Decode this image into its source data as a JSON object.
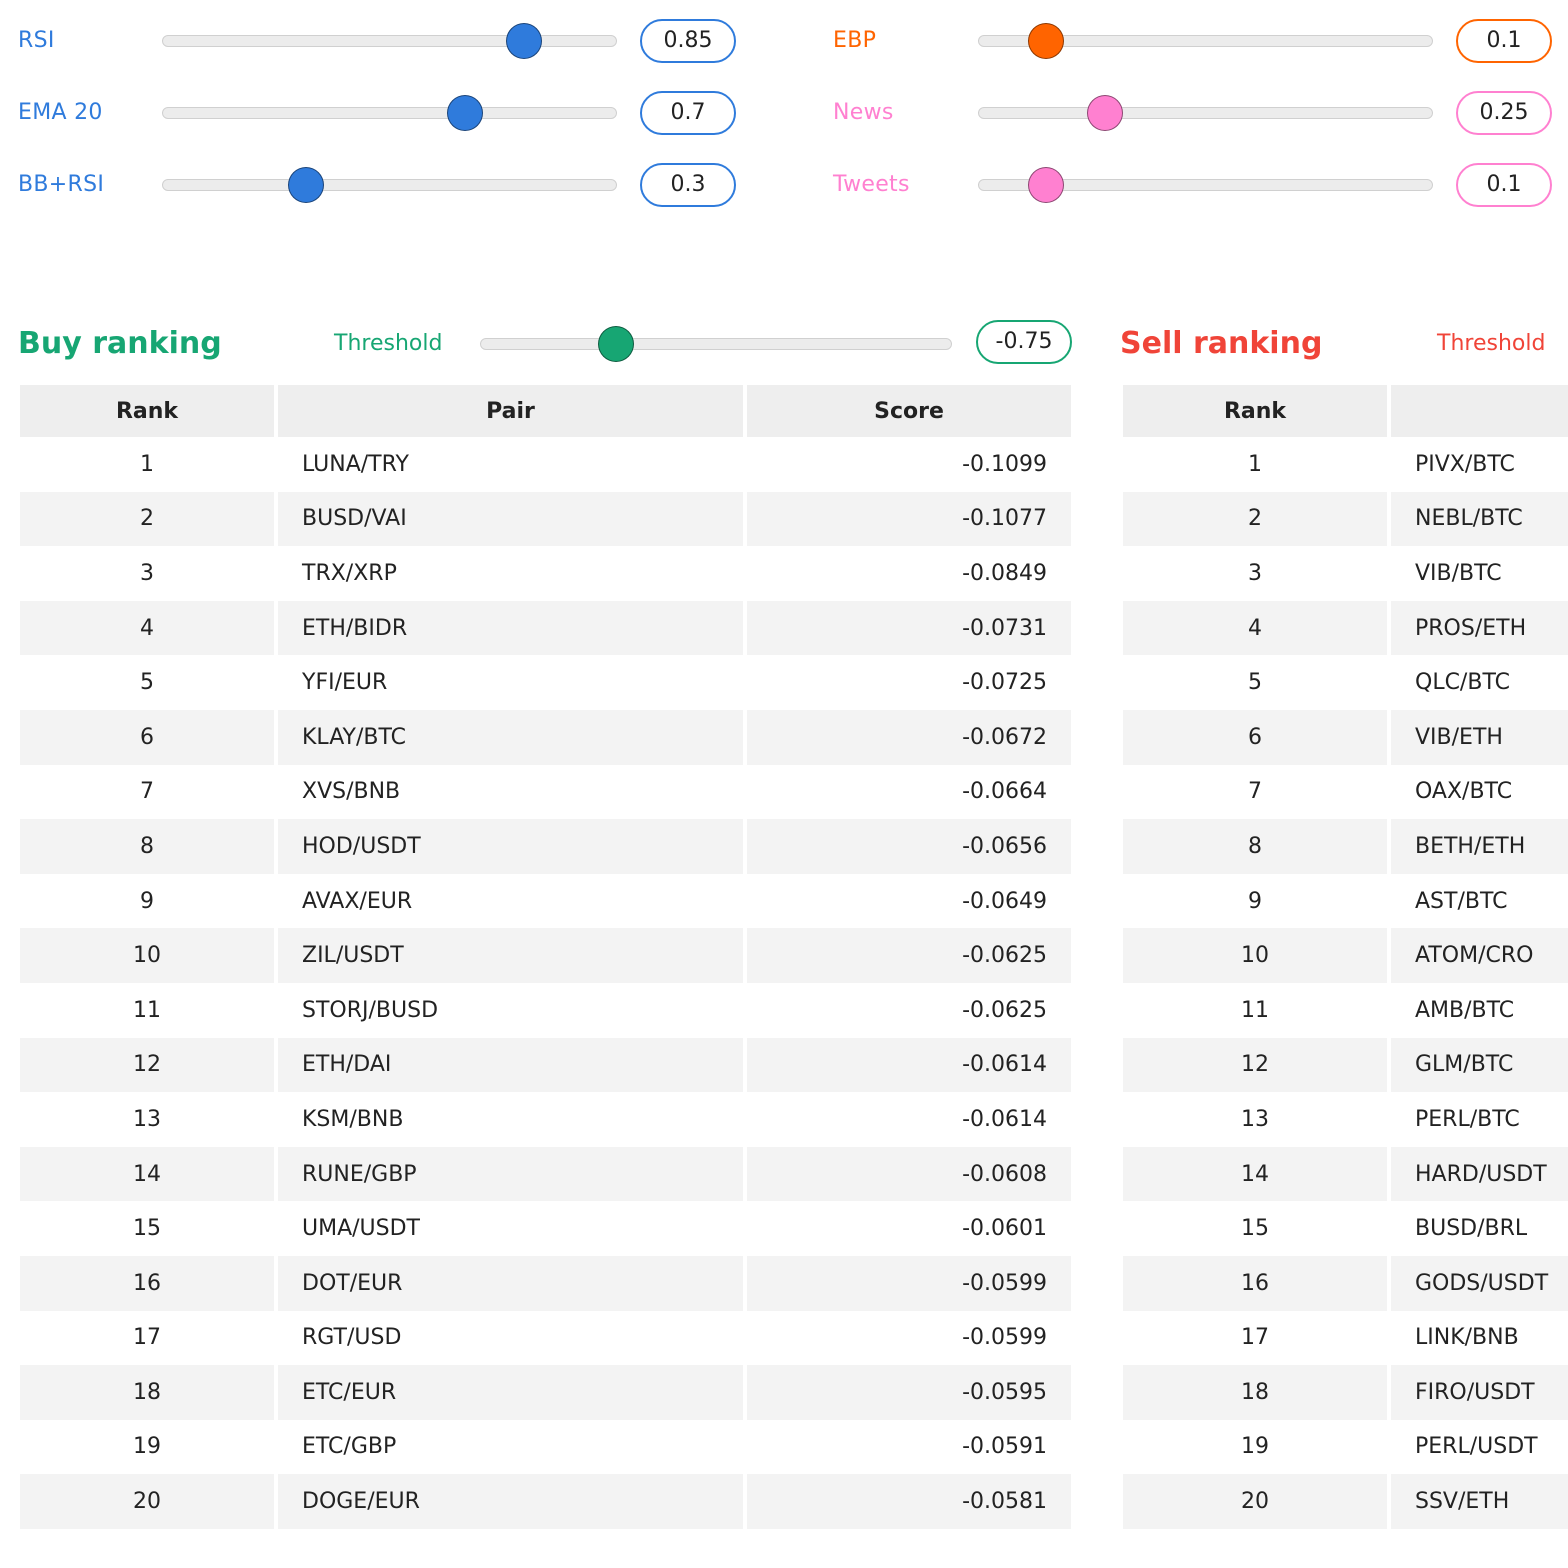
{
  "colors": {
    "blue": "#2f7bdc",
    "orange": "#ff6400",
    "pink": "#ff80d0",
    "green": "#17a673",
    "red": "#f04438"
  },
  "weights": [
    {
      "id": "rsi",
      "label": "RSI",
      "value": "0.85",
      "level": 0.82,
      "color": "#2f7bdc"
    },
    {
      "id": "ema20",
      "label": "EMA 20",
      "value": "0.7",
      "level": 0.68,
      "color": "#2f7bdc"
    },
    {
      "id": "bbrsi",
      "label": "BB+RSI",
      "value": "0.3",
      "level": 0.3,
      "color": "#2f7bdc"
    },
    {
      "id": "ebp",
      "label": "EBP",
      "value": "0.1",
      "level": 0.12,
      "color": "#ff6400"
    },
    {
      "id": "news",
      "label": "News",
      "value": "0.25",
      "level": 0.26,
      "color": "#ff80d0"
    },
    {
      "id": "tweets",
      "label": "Tweets",
      "value": "0.1",
      "level": 0.12,
      "color": "#ff80d0"
    }
  ],
  "buy": {
    "title": "Buy ranking",
    "threshold_label": "Threshold",
    "threshold_value": "-0.75",
    "threshold_level": 0.27,
    "headers": {
      "rank": "Rank",
      "pair": "Pair",
      "score": "Score"
    },
    "rows": [
      {
        "rank": "1",
        "pair": "LUNA/TRY",
        "score": "-0.1099"
      },
      {
        "rank": "2",
        "pair": "BUSD/VAI",
        "score": "-0.1077"
      },
      {
        "rank": "3",
        "pair": "TRX/XRP",
        "score": "-0.0849"
      },
      {
        "rank": "4",
        "pair": "ETH/BIDR",
        "score": "-0.0731"
      },
      {
        "rank": "5",
        "pair": "YFI/EUR",
        "score": "-0.0725"
      },
      {
        "rank": "6",
        "pair": "KLAY/BTC",
        "score": "-0.0672"
      },
      {
        "rank": "7",
        "pair": "XVS/BNB",
        "score": "-0.0664"
      },
      {
        "rank": "8",
        "pair": "HOD/USDT",
        "score": "-0.0656"
      },
      {
        "rank": "9",
        "pair": "AVAX/EUR",
        "score": "-0.0649"
      },
      {
        "rank": "10",
        "pair": "ZIL/USDT",
        "score": "-0.0625"
      },
      {
        "rank": "11",
        "pair": "STORJ/BUSD",
        "score": "-0.0625"
      },
      {
        "rank": "12",
        "pair": "ETH/DAI",
        "score": "-0.0614"
      },
      {
        "rank": "13",
        "pair": "KSM/BNB",
        "score": "-0.0614"
      },
      {
        "rank": "14",
        "pair": "RUNE/GBP",
        "score": "-0.0608"
      },
      {
        "rank": "15",
        "pair": "UMA/USDT",
        "score": "-0.0601"
      },
      {
        "rank": "16",
        "pair": "DOT/EUR",
        "score": "-0.0599"
      },
      {
        "rank": "17",
        "pair": "RGT/USD",
        "score": "-0.0599"
      },
      {
        "rank": "18",
        "pair": "ETC/EUR",
        "score": "-0.0595"
      },
      {
        "rank": "19",
        "pair": "ETC/GBP",
        "score": "-0.0591"
      },
      {
        "rank": "20",
        "pair": "DOGE/EUR",
        "score": "-0.0581"
      }
    ]
  },
  "sell": {
    "title": "Sell ranking",
    "threshold_label": "Threshold",
    "headers": {
      "rank": "Rank"
    },
    "rows": [
      {
        "rank": "1",
        "pair": "PIVX/BTC"
      },
      {
        "rank": "2",
        "pair": "NEBL/BTC"
      },
      {
        "rank": "3",
        "pair": "VIB/BTC"
      },
      {
        "rank": "4",
        "pair": "PROS/ETH"
      },
      {
        "rank": "5",
        "pair": "QLC/BTC"
      },
      {
        "rank": "6",
        "pair": "VIB/ETH"
      },
      {
        "rank": "7",
        "pair": "OAX/BTC"
      },
      {
        "rank": "8",
        "pair": "BETH/ETH"
      },
      {
        "rank": "9",
        "pair": "AST/BTC"
      },
      {
        "rank": "10",
        "pair": "ATOM/CRO"
      },
      {
        "rank": "11",
        "pair": "AMB/BTC"
      },
      {
        "rank": "12",
        "pair": "GLM/BTC"
      },
      {
        "rank": "13",
        "pair": "PERL/BTC"
      },
      {
        "rank": "14",
        "pair": "HARD/USDT"
      },
      {
        "rank": "15",
        "pair": "BUSD/BRL"
      },
      {
        "rank": "16",
        "pair": "GODS/USDT"
      },
      {
        "rank": "17",
        "pair": "LINK/BNB"
      },
      {
        "rank": "18",
        "pair": "FIRO/USDT"
      },
      {
        "rank": "19",
        "pair": "PERL/USDT"
      },
      {
        "rank": "20",
        "pair": "SSV/ETH"
      }
    ]
  }
}
